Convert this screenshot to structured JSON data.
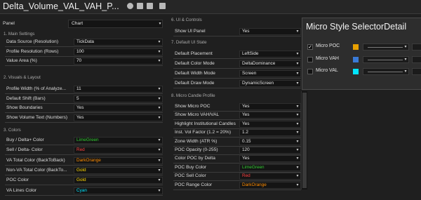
{
  "window": {
    "title": "Delta_Volume_VAL_VAH_P..."
  },
  "panel": {
    "label": "Panel",
    "value": "Chart"
  },
  "left": {
    "sections": [
      {
        "title": "1. Main Settings"
      },
      {
        "title": "2. Visuals & Layout"
      },
      {
        "title": "3. Colors"
      }
    ],
    "main_settings": [
      {
        "label": "Data Source (Resolution)",
        "value": "TickData"
      },
      {
        "label": "Profile Resolution (Rows)",
        "value": "100"
      },
      {
        "label": "Value Area (%)",
        "value": "70"
      }
    ],
    "visuals": [
      {
        "label": "Profile Width (% of Analyze...",
        "value": "11"
      },
      {
        "label": "Default Shift (Bars)",
        "value": "5"
      },
      {
        "label": "Show Boundaries",
        "value": "Yes"
      },
      {
        "label": "Show Volume Text (Numbers)",
        "value": "Yes"
      }
    ],
    "colors": [
      {
        "label": "Buy / Delta+ Color",
        "value": "LimeGreen",
        "color": "#32cd32"
      },
      {
        "label": "Sell / Delta- Color",
        "value": "Red",
        "color": "#ff4040"
      },
      {
        "label": "VA Total Color (BackToBack)",
        "value": "DarkOrange",
        "color": "#ff8c00"
      },
      {
        "label": "Non-VA Total Color (BackTo...",
        "value": "Gold",
        "color": "#ffd700"
      },
      {
        "label": "POC Color",
        "value": "Gold",
        "color": "#ffd700"
      },
      {
        "label": "VA Lines Color",
        "value": "Cyan",
        "color": "#00e5ff"
      }
    ]
  },
  "right": {
    "sections": [
      {
        "title": "6. UI & Controls"
      },
      {
        "title": "7. Default UI State"
      },
      {
        "title": "8. Micro Candle Profile"
      }
    ],
    "ui_controls": [
      {
        "label": "Show UI Panel",
        "value": "Yes"
      }
    ],
    "ui_state": [
      {
        "label": "Default Placement",
        "value": "LeftSide"
      },
      {
        "label": "Default Color Mode",
        "value": "DeltaDominance"
      },
      {
        "label": "Default Width Mode",
        "value": "Screen"
      },
      {
        "label": "Default Draw Mode",
        "value": "DynamicScreen"
      }
    ],
    "micro_profile": [
      {
        "label": "Show Micro POC",
        "value": "Yes",
        "color": ""
      },
      {
        "label": "Show Micro VAH/VAL",
        "value": "Yes",
        "color": ""
      },
      {
        "label": "Highlight Institutional Candles",
        "value": "Yes",
        "color": ""
      },
      {
        "label": "Inst. Vol Factor (1.2 = 20%)",
        "value": "1.2",
        "color": ""
      },
      {
        "label": "Zone Width (ATR %)",
        "value": "0.15",
        "color": ""
      },
      {
        "label": "POC Opacity (0-255)",
        "value": "120",
        "color": ""
      },
      {
        "label": "Color POC by Delta",
        "value": "Yes",
        "color": ""
      },
      {
        "label": "POC Buy Color",
        "value": "LimeGreen",
        "color": "#32cd32"
      },
      {
        "label": "POC Sell Color",
        "value": "Red",
        "color": "#ff4040"
      },
      {
        "label": "POC Range Color",
        "value": "DarkOrange",
        "color": "#ff8c00"
      }
    ]
  },
  "micro_panel": {
    "title": "Micro Style SelectorDetail",
    "rows": [
      {
        "label": "Micro POC",
        "checked": true,
        "check_mark": "✓",
        "color": "#e8a000"
      },
      {
        "label": "Micro VAH",
        "checked": false,
        "check_mark": "",
        "color": "#3a7ad6"
      },
      {
        "label": "Micro VAL",
        "checked": false,
        "check_mark": "",
        "color": "#00e5ff"
      }
    ]
  },
  "icons": {
    "info": "info-icon",
    "window1": "window-icon",
    "window2": "window-icon",
    "delete": "trash-icon"
  },
  "glyphs": {
    "dropdown": "▾"
  }
}
